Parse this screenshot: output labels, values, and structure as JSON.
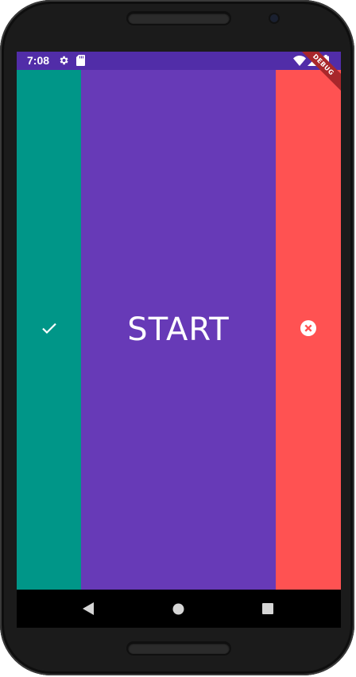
{
  "status_bar": {
    "time": "7:08",
    "background": "#512da8",
    "icons": [
      "settings-icon",
      "sd-card-icon",
      "wifi-icon",
      "signal-icon",
      "battery-icon"
    ]
  },
  "debug_banner": {
    "label": "DEBUG",
    "color": "#a8272b"
  },
  "swipe_card": {
    "label": "START",
    "colors": {
      "accept": "#009688",
      "center": "#673ab7",
      "reject": "#ff5252"
    },
    "accept_icon": "check-icon",
    "reject_icon": "cancel-circle-icon"
  },
  "nav_bar": {
    "icons": [
      "back-icon",
      "home-icon",
      "recents-icon"
    ]
  }
}
